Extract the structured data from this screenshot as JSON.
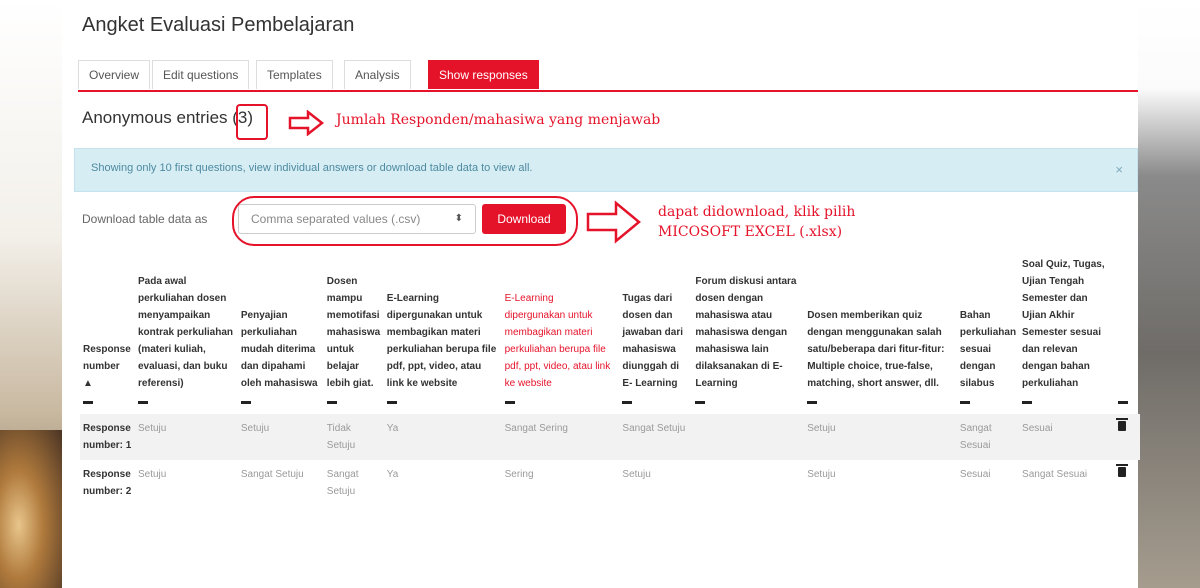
{
  "page_title": "Angket Evaluasi Pembelajaran",
  "tabs": [
    {
      "label": "Overview"
    },
    {
      "label": "Edit questions"
    },
    {
      "label": "Templates"
    },
    {
      "label": "Analysis"
    },
    {
      "label": "Show responses",
      "active": true
    }
  ],
  "anonymous": {
    "label": "Anonymous entries",
    "count": "(3)"
  },
  "annotations": {
    "respondents": "Jumlah Responden/mahasiwa yang menjawab",
    "download_line1": "dapat didownload, klik pilih",
    "download_line2": "MICOSOFT EXCEL (.xlsx)"
  },
  "alert": {
    "text": "Showing only 10 first questions, view individual answers or download table data to view all.",
    "close": "×"
  },
  "download": {
    "label": "Download table data as",
    "selected": "Comma separated values (.csv)",
    "caret": "⬍",
    "button": "Download"
  },
  "table": {
    "headers": [
      "Response number ▲",
      "Pada awal perkuliahan dosen menyampaikan kontrak perkuliahan (materi kuliah, evaluasi, dan buku referensi)",
      "Penyajian perkuliahan mudah diterima dan dipahami oleh mahasiswa",
      "Dosen mampu memotifasi mahasiswa untuk belajar lebih giat.",
      "E-Learning dipergunakan untuk membagikan materi perkuliahan berupa file pdf, ppt, video, atau link ke website",
      "E-Learning dipergunakan untuk membagikan materi perkuliahan berupa file pdf, ppt, video, atau link ke website",
      "Tugas dari dosen dan jawaban dari mahasiswa diunggah di E- Learning",
      "Forum diskusi antara dosen dengan mahasiswa atau mahasiswa dengan mahasiswa lain dilaksanakan di E-Learning",
      "Dosen memberikan quiz dengan menggunakan salah satu/beberapa dari fitur-fitur: Multiple choice, true-false, matching, short answer, dll.",
      "Bahan perkuliahan sesuai dengan silabus",
      "Soal Quiz, Tugas, Ujian Tengah Semester dan Ujian Akhir Semester sesuai dan relevan dengan bahan perkuliahan"
    ],
    "rows": [
      {
        "number": "Response number: 1",
        "cells": [
          "Setuju",
          "Setuju",
          "Tidak Setuju",
          "Ya",
          "Sangat Sering",
          "Sangat Setuju",
          "",
          "Setuju",
          "Sangat Sesuai",
          "Sesuai"
        ]
      },
      {
        "number": "Response number: 2",
        "cells": [
          "Setuju",
          "Sangat Setuju",
          "Sangat Setuju",
          "Ya",
          "Sering",
          "Setuju",
          "",
          "Setuju",
          "Sesuai",
          "Sangat Sesuai"
        ]
      }
    ]
  },
  "colors": {
    "accent": "#e5132a",
    "alert_bg": "#d6edf4"
  }
}
